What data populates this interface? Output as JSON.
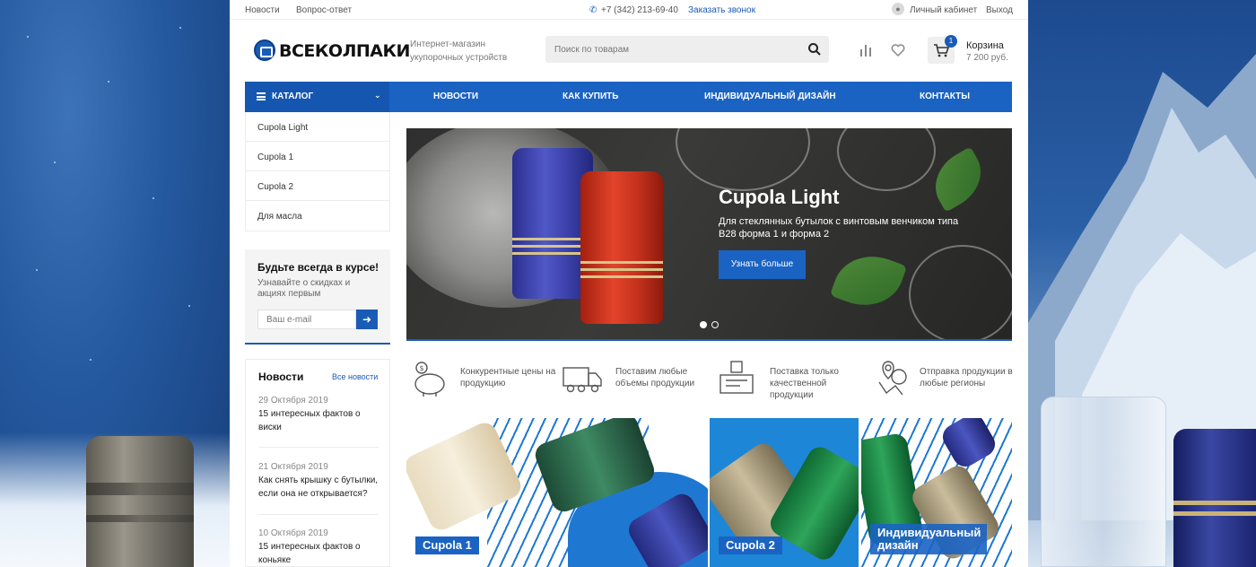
{
  "topbar": {
    "links": [
      "Новости",
      "Вопрос-ответ"
    ],
    "phone": "+7 (342) 213-69-40",
    "callback": "Заказать звонок",
    "account": "Личный кабинет",
    "logout": "Выход"
  },
  "header": {
    "logo": "ВСЕКОЛПАКИ",
    "tagline": "Интернет-магазин укупорочных устройств",
    "search_placeholder": "Поиск по товарам",
    "cart_label": "Корзина",
    "cart_total": "7 200 руб.",
    "cart_count": "1"
  },
  "nav": {
    "catalog": "КАТАЛОГ",
    "items": [
      "НОВОСТИ",
      "КАК КУПИТЬ",
      "ИНДИВИДУАЛЬНЫЙ ДИЗАЙН",
      "КОНТАКТЫ"
    ]
  },
  "catalog_menu": [
    "Cupola Light",
    "Cupola 1",
    "Cupola 2",
    "Для масла"
  ],
  "subscribe": {
    "title": "Будьте всегда в курсе!",
    "text": "Узнавайте о скидках и акциях первым",
    "placeholder": "Ваш e-mail"
  },
  "news": {
    "title": "Новости",
    "all": "Все новости",
    "items": [
      {
        "date": "29 Октября 2019",
        "title": "15 интересных фактов о виски"
      },
      {
        "date": "21 Октября 2019",
        "title": "Как снять крышку с бутылки, если она не открывается?"
      },
      {
        "date": "10 Октября 2019",
        "title": "15 интересных фактов о коньяке"
      }
    ]
  },
  "banner": {
    "title": "Cupola Light",
    "subtitle": "Для стеклянных бутылок с винтовым венчиком типа В28 форма 1 и форма 2",
    "button": "Узнать больше"
  },
  "features": [
    {
      "icon": "piggy-bank-icon",
      "text": "Конкурентные цены на продукцию"
    },
    {
      "icon": "truck-icon",
      "text": "Поставим любые объемы продукции"
    },
    {
      "icon": "quality-scale-icon",
      "text": "Поставка только качественной продукции"
    },
    {
      "icon": "map-pin-icon",
      "text": "Отправка продукции в любые регионы"
    }
  ],
  "cards": [
    "Cupola 1",
    "Cupola 2",
    "Индивидуальный дизайн"
  ],
  "colors": {
    "brand": "#1a63c3",
    "brand_dark": "#1557b0"
  }
}
